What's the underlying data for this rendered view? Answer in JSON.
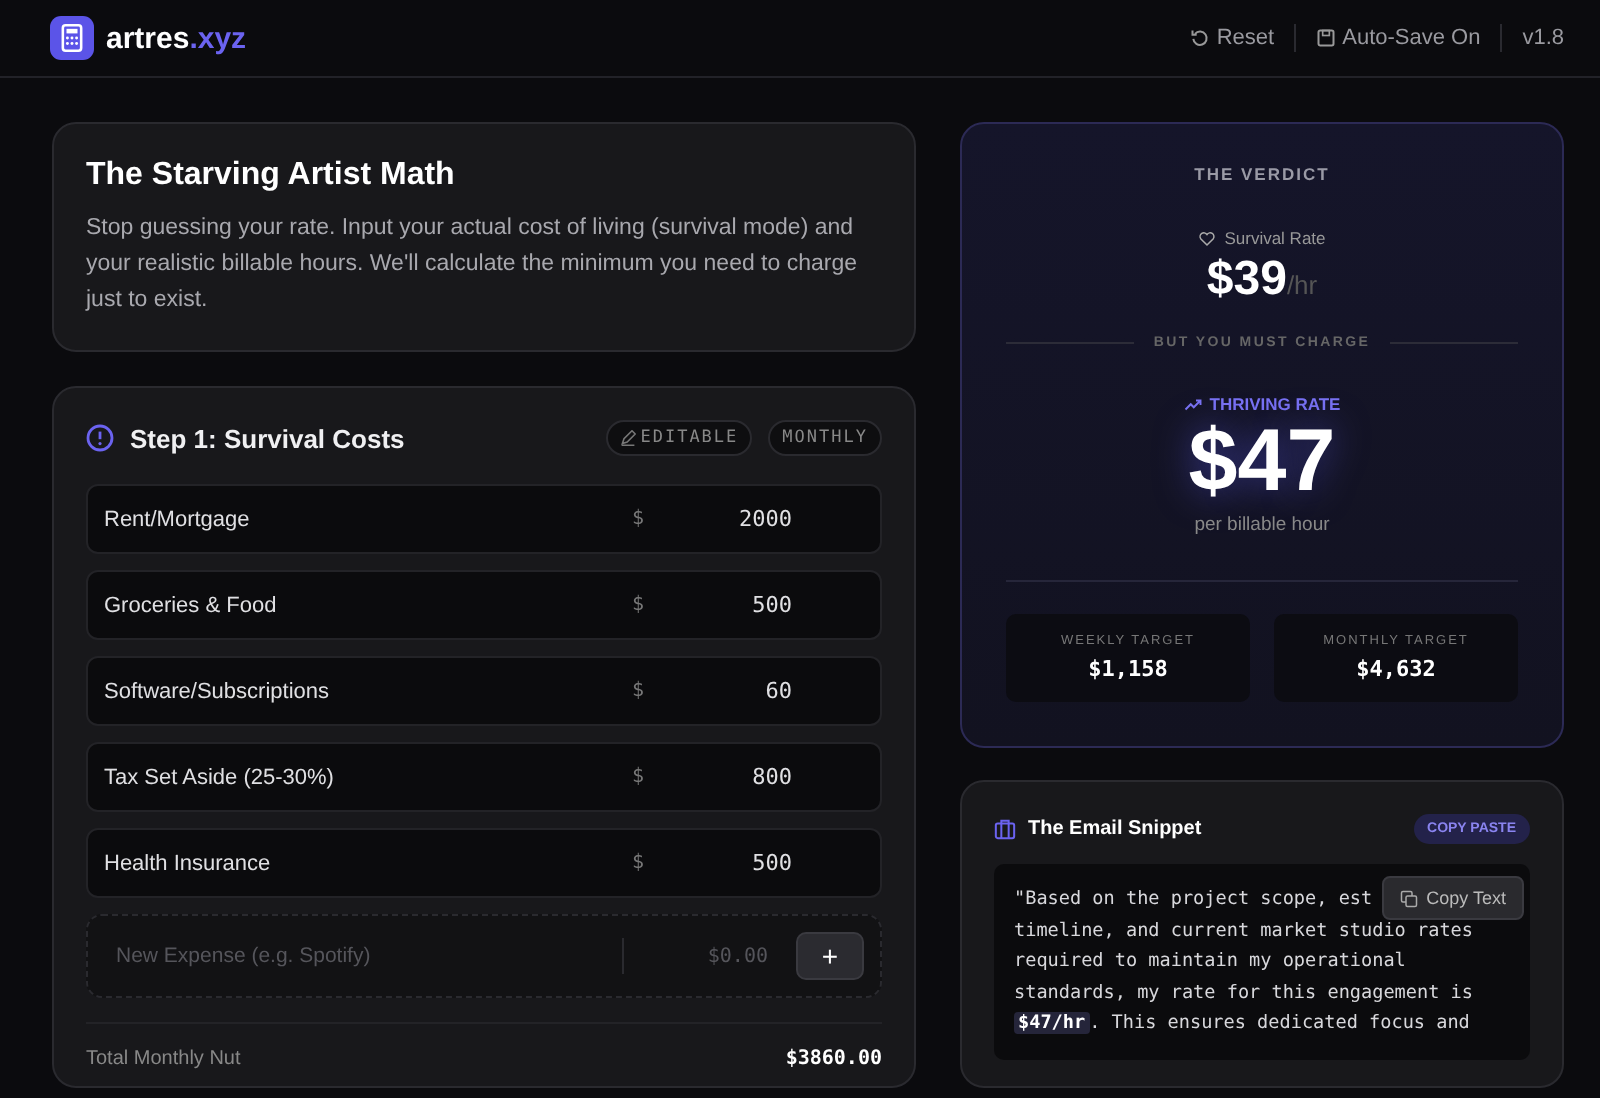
{
  "header": {
    "brand": "artres",
    "brand_suffix": ".xyz",
    "actions": [
      {
        "label": "Reset"
      },
      {
        "label": "Auto-Save On"
      }
    ],
    "version": "v1.8"
  },
  "intro": {
    "title": "The Starving Artist Math",
    "text": "Stop guessing your rate. Input your actual cost of living (survival mode) and your realistic billable hours. We'll calculate the minimum you need to charge just to exist."
  },
  "costs": {
    "title": "Step 1: Survival Costs",
    "badges": [
      {
        "label": "EDITABLE",
        "icon": true
      },
      {
        "label": "MONTHLY",
        "icon": false
      }
    ],
    "items": [
      {
        "name": "Rent/Mortgage",
        "currency": "$",
        "value": "2000"
      },
      {
        "name": "Groceries & Food",
        "currency": "$",
        "value": "500"
      },
      {
        "name": "Software/Subscriptions",
        "currency": "$",
        "value": "60"
      },
      {
        "name": "Tax Set Aside (25-30%)",
        "currency": "$",
        "value": "800"
      },
      {
        "name": "Health Insurance",
        "currency": "$",
        "value": "500"
      }
    ],
    "new_expense": {
      "name_placeholder": "New Expense (e.g. Spotify)",
      "amount_placeholder": "$0.00",
      "add_button": "+"
    },
    "total_label": "Total Monthly Nut",
    "total_value": "$3860.00"
  },
  "verdict": {
    "title": "THE VERDICT",
    "survival_label": "Survival Rate",
    "survival_rate": "$39",
    "survival_unit": "/hr",
    "divider_label": "BUT YOU MUST CHARGE",
    "thriving_label": "THRIVING RATE",
    "thriving_rate": "$47",
    "thriving_caption": "per billable hour",
    "targets": [
      {
        "label": "WEEKLY TARGET",
        "value": "$1,158"
      },
      {
        "label": "MONTHLY TARGET",
        "value": "$4,632"
      }
    ]
  },
  "email": {
    "title": "The Email Snippet",
    "badge": "COPY PASTE",
    "copy_button": "Copy Text",
    "lines": [
      "\"Based on the project scope, est",
      "timeline, and current market studio rates",
      "required to maintain my operational",
      "standards, my rate for this engagement is",
      "**$47/hr**. This ensures dedicated focus and"
    ]
  }
}
